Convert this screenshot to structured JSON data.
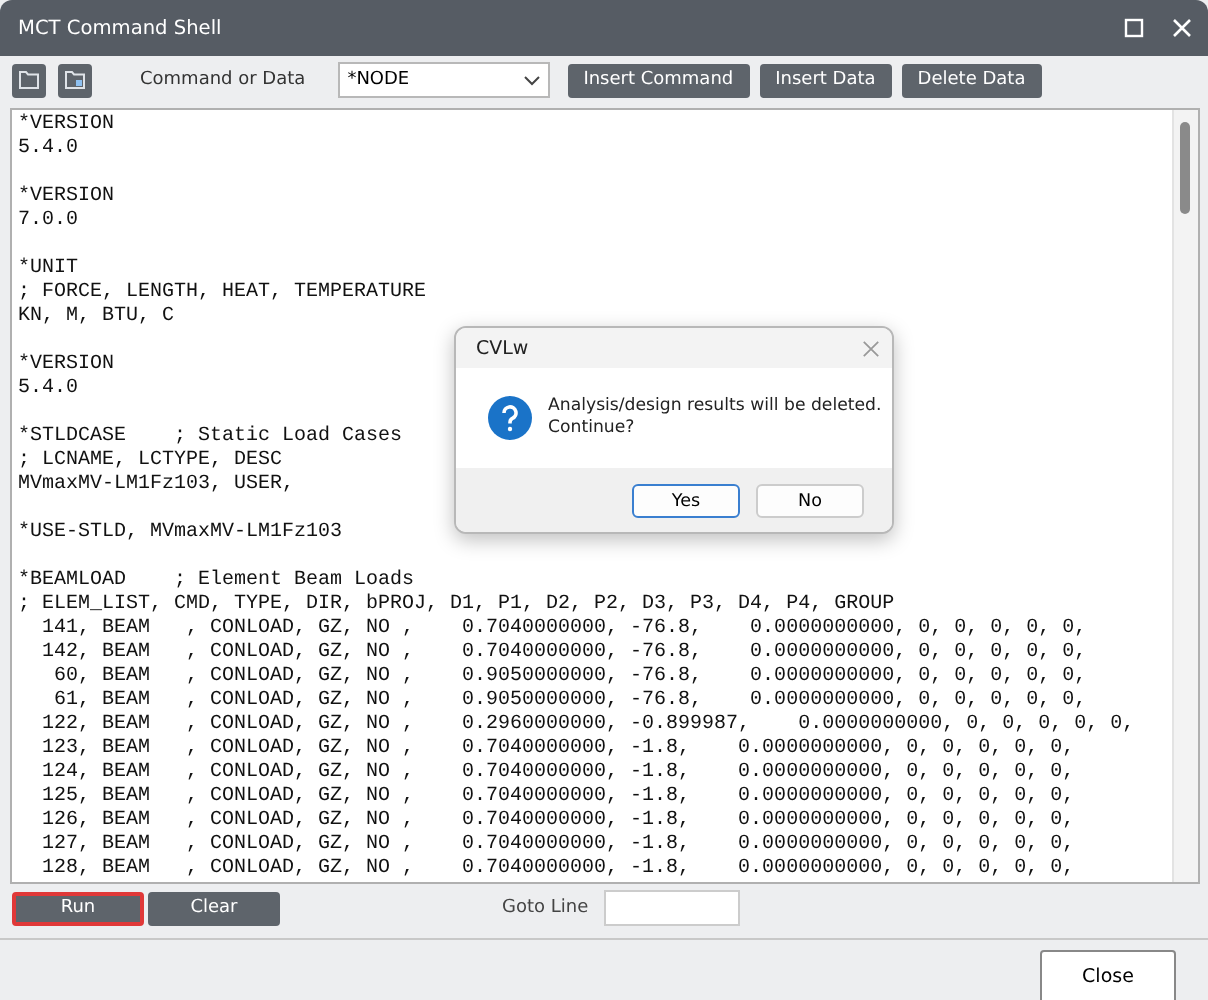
{
  "window": {
    "title": "MCT Command Shell"
  },
  "toolbar": {
    "label": "Command or Data",
    "command": {
      "value": "*NODE"
    },
    "buttons": [
      "Insert Command",
      "Insert Data",
      "Delete Data"
    ]
  },
  "editor": {
    "blocks": [
      [
        "*VERSION",
        "5.4.0"
      ],
      [
        "*VERSION",
        "7.0.0"
      ],
      [
        "*UNIT",
        "; FORCE, LENGTH, HEAT, TEMPERATURE",
        "KN, M, BTU, C"
      ],
      [
        "*VERSION",
        "5.4.0"
      ],
      [
        "*STLDCASE    ; Static Load Cases",
        "; LCNAME, LCTYPE, DESC",
        "MVmaxMV-LM1Fz103, USER,"
      ],
      [
        "*USE-STLD, MVmaxMV-LM1Fz103"
      ],
      [
        "*BEAMLOAD    ; Element Beam Loads",
        "; ELEM_LIST, CMD, TYPE, DIR, bPROJ, D1, P1, D2, P2, D3, P3, D4, P4, GROUP",
        "  141, BEAM   , CONLOAD, GZ, NO ,    0.7040000000, -76.8,    0.0000000000, 0, 0, 0, 0, 0,",
        "  142, BEAM   , CONLOAD, GZ, NO ,    0.7040000000, -76.8,    0.0000000000, 0, 0, 0, 0, 0,",
        "   60, BEAM   , CONLOAD, GZ, NO ,    0.9050000000, -76.8,    0.0000000000, 0, 0, 0, 0, 0,",
        "   61, BEAM   , CONLOAD, GZ, NO ,    0.9050000000, -76.8,    0.0000000000, 0, 0, 0, 0, 0,",
        "  122, BEAM   , CONLOAD, GZ, NO ,    0.2960000000, -0.899987,    0.0000000000, 0, 0, 0, 0, 0,",
        "  123, BEAM   , CONLOAD, GZ, NO ,    0.7040000000, -1.8,    0.0000000000, 0, 0, 0, 0, 0,",
        "  124, BEAM   , CONLOAD, GZ, NO ,    0.7040000000, -1.8,    0.0000000000, 0, 0, 0, 0, 0,",
        "  125, BEAM   , CONLOAD, GZ, NO ,    0.7040000000, -1.8,    0.0000000000, 0, 0, 0, 0, 0,",
        "  126, BEAM   , CONLOAD, GZ, NO ,    0.7040000000, -1.8,    0.0000000000, 0, 0, 0, 0, 0,",
        "  127, BEAM   , CONLOAD, GZ, NO ,    0.7040000000, -1.8,    0.0000000000, 0, 0, 0, 0, 0,",
        "  128, BEAM   , CONLOAD, GZ, NO ,    0.7040000000, -1.8,    0.0000000000, 0, 0, 0, 0, 0,"
      ]
    ]
  },
  "actions": [
    {
      "label": "Run",
      "highlighted": true
    },
    {
      "label": "Clear",
      "highlighted": false
    }
  ],
  "goto": {
    "label": "Goto Line"
  },
  "footer": {
    "button": "Close"
  },
  "dialog": {
    "title": "CVLw",
    "message": "Analysis/design results will be deleted.\nContinue?",
    "buttons": [
      {
        "label": "Yes",
        "default": true
      },
      {
        "label": "No",
        "default": false
      }
    ]
  }
}
